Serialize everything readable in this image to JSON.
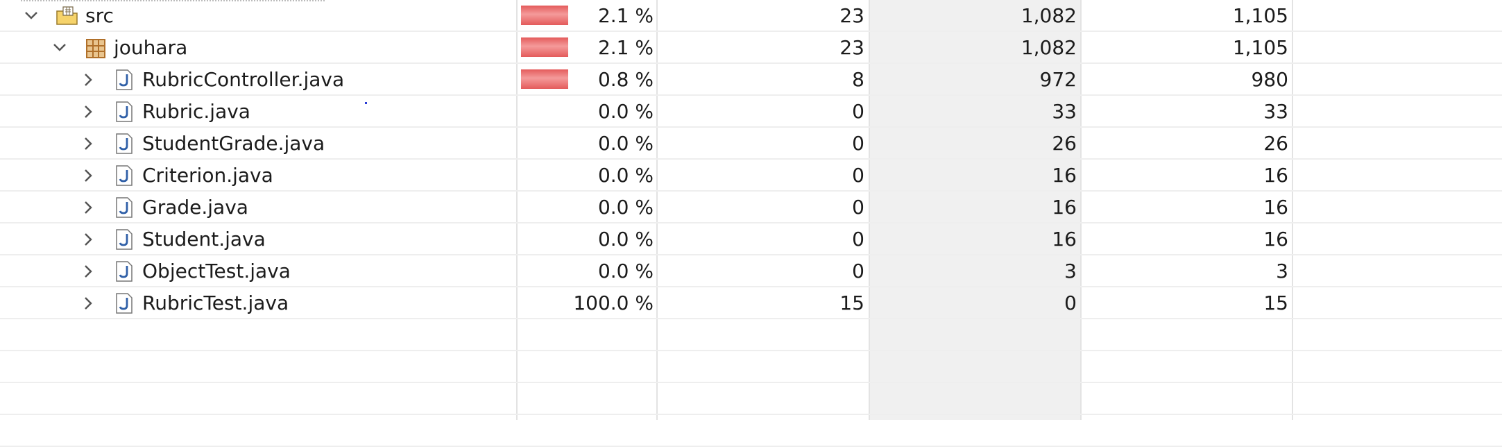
{
  "coverage_table": {
    "rows": [
      {
        "name": "src",
        "kind": "folder",
        "expanded": true,
        "coverage": "2.1 %",
        "covered": "23",
        "missed": "1,082",
        "total": "1,105",
        "coverage_fraction": 0.021
      },
      {
        "name": "jouhara",
        "kind": "package",
        "expanded": true,
        "coverage": "2.1 %",
        "covered": "23",
        "missed": "1,082",
        "total": "1,105",
        "coverage_fraction": 0.021
      },
      {
        "name": "RubricController.java",
        "kind": "java-file",
        "expanded": false,
        "coverage": "0.8 %",
        "covered": "8",
        "missed": "972",
        "total": "980",
        "coverage_fraction": 0.008
      },
      {
        "name": "Rubric.java",
        "kind": "java-file",
        "expanded": false,
        "coverage": "0.0 %",
        "covered": "0",
        "missed": "33",
        "total": "33",
        "coverage_fraction": 0
      },
      {
        "name": "StudentGrade.java",
        "kind": "java-file",
        "expanded": false,
        "coverage": "0.0 %",
        "covered": "0",
        "missed": "26",
        "total": "26",
        "coverage_fraction": 0
      },
      {
        "name": "Criterion.java",
        "kind": "java-file",
        "expanded": false,
        "coverage": "0.0 %",
        "covered": "0",
        "missed": "16",
        "total": "16",
        "coverage_fraction": 0
      },
      {
        "name": "Grade.java",
        "kind": "java-file",
        "expanded": false,
        "coverage": "0.0 %",
        "covered": "0",
        "missed": "16",
        "total": "16",
        "coverage_fraction": 0
      },
      {
        "name": "Student.java",
        "kind": "java-file",
        "expanded": false,
        "coverage": "0.0 %",
        "covered": "0",
        "missed": "16",
        "total": "16",
        "coverage_fraction": 0
      },
      {
        "name": "ObjectTest.java",
        "kind": "java-file",
        "expanded": false,
        "coverage": "0.0 %",
        "covered": "0",
        "missed": "3",
        "total": "3",
        "coverage_fraction": 0
      },
      {
        "name": "RubricTest.java",
        "kind": "java-file",
        "expanded": false,
        "coverage": "100.0 %",
        "covered": "15",
        "missed": "0",
        "total": "15",
        "coverage_fraction": 1
      }
    ]
  },
  "colors": {
    "missed_bar": "#e45b5b",
    "selected_column": "#f0f0f0",
    "java_icon": "#2f5fa7",
    "package_icon": "#b0702a"
  }
}
